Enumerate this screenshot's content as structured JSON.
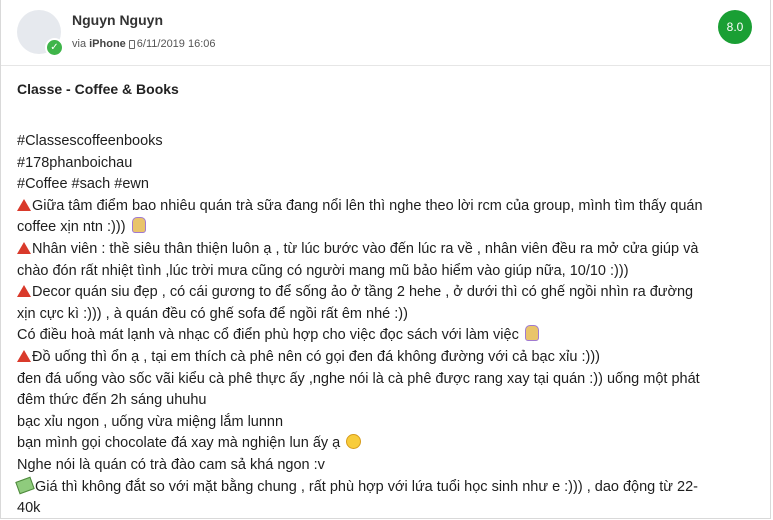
{
  "post": {
    "author": "Nguyn Nguyn",
    "via_label": "via",
    "via_device": "iPhone",
    "timestamp": "6/11/2019 16:06",
    "score": "8.0",
    "title": "Classe - Coffee & Books",
    "lines": [
      "#Classescoffeenbooks",
      "#178phanboichau",
      "#Coffee #sach #ewn",
      "Giữa tâm điểm bao nhiêu quán trà sữa đang nổi lên thì nghe theo lời rcm của group, mình tìm thấy quán",
      "coffee xịn ntn :)))",
      "Nhân viên : thề siêu thân thiện luôn ạ , từ lúc bước vào đến lúc ra về , nhân viên đều ra mở cửa giúp và",
      "chào đón rất nhiệt tình ,lúc trời mưa cũng có người mang mũ bảo hiểm vào giúp nữa, 10/10 :)))",
      "Decor quán siu đẹp , có cái gương to để sống ảo ở tầng 2 hehe , ở dưới thì có ghế ngồi nhìn ra đường",
      "xịn cực kì :))) , à quán đều có ghế sofa để ngồi rất êm nhé :))",
      "Có điều hoà mát lạnh và nhạc cổ điển phù hợp cho việc đọc sách với làm việc",
      "Đồ uống thì ổn ạ , tại em thích cà phê nên có gọi đen đá không đường với cả bạc xỉu :)))",
      "đen đá uống vào sốc vãi kiểu cà phê thực ấy ,nghe nói là cà phê được rang xay tại quán :)) uống một phát",
      "đêm thức đến 2h sáng uhuhu",
      "bạc xỉu ngon , uống vừa miệng lắm lunnn",
      "bạn mình gọi chocolate đá xay mà nghiện lun ấy ạ",
      "Nghe nói là quán có trà đào cam sả khá ngon :v",
      "Giá thì không đắt so với mặt bằng chung , rất phù hợp với lứa tuổi học sinh như e :))) , dao động từ 22-",
      "40k"
    ]
  }
}
